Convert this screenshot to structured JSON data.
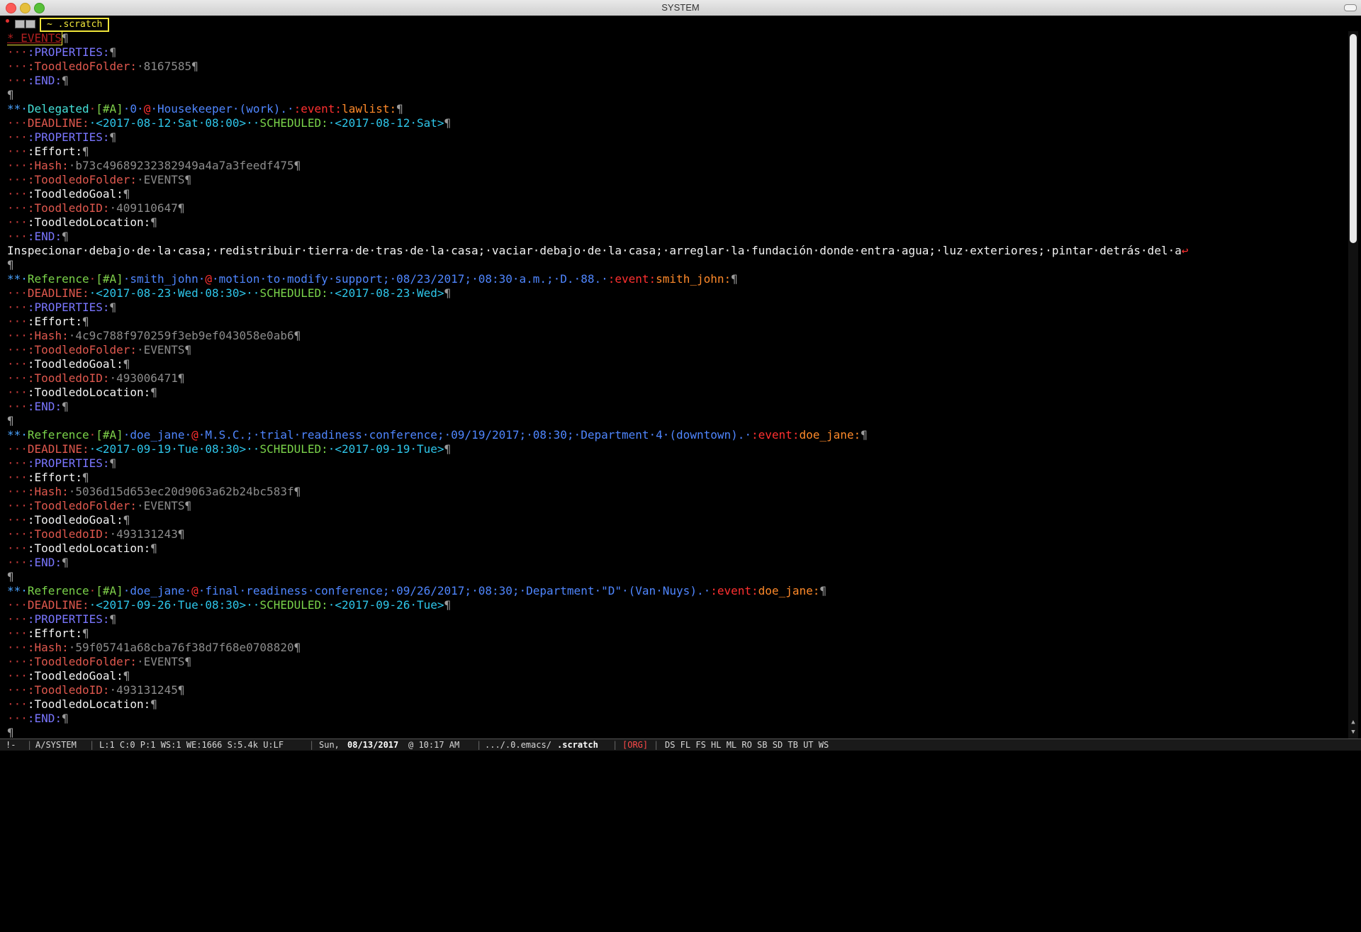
{
  "window": {
    "title": "SYSTEM"
  },
  "tabbar": {
    "buffer_label": "~ .scratch"
  },
  "pilcrow": "¶",
  "lines": [
    {
      "segments": [
        {
          "t": "* EVENTS",
          "c": "head-events cursor"
        },
        {
          "t": "¶",
          "c": "pilcrow"
        }
      ]
    },
    {
      "segments": [
        {
          "t": "···",
          "c": "dots"
        },
        {
          "t": ":PROPERTIES:",
          "c": "drawer"
        },
        {
          "t": "¶",
          "c": "pilcrow"
        }
      ]
    },
    {
      "segments": [
        {
          "t": "···",
          "c": "dots"
        },
        {
          "t": ":ToodledoFolder:",
          "c": "kw-red"
        },
        {
          "t": "·8167585",
          "c": "val-gray"
        },
        {
          "t": "¶",
          "c": "pilcrow"
        }
      ]
    },
    {
      "segments": [
        {
          "t": "···",
          "c": "dots"
        },
        {
          "t": ":END:",
          "c": "drawer"
        },
        {
          "t": "¶",
          "c": "pilcrow"
        }
      ]
    },
    {
      "segments": [
        {
          "t": "¶",
          "c": "pilcrow"
        }
      ]
    },
    {
      "segments": [
        {
          "t": "**·",
          "c": "star"
        },
        {
          "t": "Delegated",
          "c": "todo"
        },
        {
          "t": "·",
          "c": "dots"
        },
        {
          "t": "[#A]",
          "c": "prio"
        },
        {
          "t": "·0·",
          "c": "blue"
        },
        {
          "t": "@",
          "c": "event-red"
        },
        {
          "t": "·Housekeeper·(work).·",
          "c": "blue"
        },
        {
          "t": ":event:",
          "c": "event-red"
        },
        {
          "t": "lawlist:",
          "c": "tag-orange"
        },
        {
          "t": "¶",
          "c": "pilcrow"
        }
      ]
    },
    {
      "segments": [
        {
          "t": "···",
          "c": "dots"
        },
        {
          "t": "DEADLINE:",
          "c": "kw-red"
        },
        {
          "t": "·<2017-08-12·Sat·08:00>··",
          "c": "cyan"
        },
        {
          "t": "SCHEDULED:",
          "c": "green"
        },
        {
          "t": "·<2017-08-12·Sat>",
          "c": "cyan"
        },
        {
          "t": "¶",
          "c": "pilcrow"
        }
      ]
    },
    {
      "segments": [
        {
          "t": "···",
          "c": "dots"
        },
        {
          "t": ":PROPERTIES:",
          "c": "drawer"
        },
        {
          "t": "¶",
          "c": "pilcrow"
        }
      ]
    },
    {
      "segments": [
        {
          "t": "···",
          "c": "dots"
        },
        {
          "t": ":Effort:",
          "c": "kw-white"
        },
        {
          "t": "¶",
          "c": "pilcrow"
        }
      ]
    },
    {
      "segments": [
        {
          "t": "···",
          "c": "dots"
        },
        {
          "t": ":Hash:",
          "c": "kw-red"
        },
        {
          "t": "·b73c49689232382949a4a7a3feedf475",
          "c": "val-gray"
        },
        {
          "t": "¶",
          "c": "pilcrow"
        }
      ]
    },
    {
      "segments": [
        {
          "t": "···",
          "c": "dots"
        },
        {
          "t": ":ToodledoFolder:",
          "c": "kw-red"
        },
        {
          "t": "·EVENTS",
          "c": "val-gray"
        },
        {
          "t": "¶",
          "c": "pilcrow"
        }
      ]
    },
    {
      "segments": [
        {
          "t": "···",
          "c": "dots"
        },
        {
          "t": ":ToodledoGoal:",
          "c": "kw-white"
        },
        {
          "t": "¶",
          "c": "pilcrow"
        }
      ]
    },
    {
      "segments": [
        {
          "t": "···",
          "c": "dots"
        },
        {
          "t": ":ToodledoID:",
          "c": "kw-red"
        },
        {
          "t": "·409110647",
          "c": "val-gray"
        },
        {
          "t": "¶",
          "c": "pilcrow"
        }
      ]
    },
    {
      "segments": [
        {
          "t": "···",
          "c": "dots"
        },
        {
          "t": ":ToodledoLocation:",
          "c": "kw-white"
        },
        {
          "t": "¶",
          "c": "pilcrow"
        }
      ]
    },
    {
      "segments": [
        {
          "t": "···",
          "c": "dots"
        },
        {
          "t": ":END:",
          "c": "drawer"
        },
        {
          "t": "¶",
          "c": "pilcrow"
        }
      ]
    },
    {
      "segments": [
        {
          "t": "Inspecionar·debajo·de·la·casa;·redistribuir·tierra·de·tras·de·la·casa;·vaciar·debajo·de·la·casa;·arreglar·la·fundación·donde·entra·agua;·luz·exteriores;·pintar·detrás·del·a",
          "c": "kw-white"
        },
        {
          "t": "↩",
          "c": "event-red"
        }
      ]
    },
    {
      "segments": [
        {
          "t": "¶",
          "c": "pilcrow"
        }
      ]
    },
    {
      "segments": [
        {
          "t": "**·",
          "c": "star"
        },
        {
          "t": "Reference",
          "c": "green"
        },
        {
          "t": "·",
          "c": "dots"
        },
        {
          "t": "[#A]",
          "c": "prio"
        },
        {
          "t": "·smith_john·",
          "c": "blue"
        },
        {
          "t": "@",
          "c": "event-red"
        },
        {
          "t": "·motion·to·modify·support;·08/23/2017;·08:30·a.m.;·D.·88.·",
          "c": "blue"
        },
        {
          "t": ":event:",
          "c": "event-red"
        },
        {
          "t": "smith_john:",
          "c": "tag-orange"
        },
        {
          "t": "¶",
          "c": "pilcrow"
        }
      ]
    },
    {
      "segments": [
        {
          "t": "···",
          "c": "dots"
        },
        {
          "t": "DEADLINE:",
          "c": "kw-red"
        },
        {
          "t": "·<2017-08-23·Wed·08:30>··",
          "c": "cyan"
        },
        {
          "t": "SCHEDULED:",
          "c": "green"
        },
        {
          "t": "·<2017-08-23·Wed>",
          "c": "cyan"
        },
        {
          "t": "¶",
          "c": "pilcrow"
        }
      ]
    },
    {
      "segments": [
        {
          "t": "···",
          "c": "dots"
        },
        {
          "t": ":PROPERTIES:",
          "c": "drawer"
        },
        {
          "t": "¶",
          "c": "pilcrow"
        }
      ]
    },
    {
      "segments": [
        {
          "t": "···",
          "c": "dots"
        },
        {
          "t": ":Effort:",
          "c": "kw-white"
        },
        {
          "t": "¶",
          "c": "pilcrow"
        }
      ]
    },
    {
      "segments": [
        {
          "t": "···",
          "c": "dots"
        },
        {
          "t": ":Hash:",
          "c": "kw-red"
        },
        {
          "t": "·4c9c788f970259f3eb9ef043058e0ab6",
          "c": "val-gray"
        },
        {
          "t": "¶",
          "c": "pilcrow"
        }
      ]
    },
    {
      "segments": [
        {
          "t": "···",
          "c": "dots"
        },
        {
          "t": ":ToodledoFolder:",
          "c": "kw-red"
        },
        {
          "t": "·EVENTS",
          "c": "val-gray"
        },
        {
          "t": "¶",
          "c": "pilcrow"
        }
      ]
    },
    {
      "segments": [
        {
          "t": "···",
          "c": "dots"
        },
        {
          "t": ":ToodledoGoal:",
          "c": "kw-white"
        },
        {
          "t": "¶",
          "c": "pilcrow"
        }
      ]
    },
    {
      "segments": [
        {
          "t": "···",
          "c": "dots"
        },
        {
          "t": ":ToodledoID:",
          "c": "kw-red"
        },
        {
          "t": "·493006471",
          "c": "val-gray"
        },
        {
          "t": "¶",
          "c": "pilcrow"
        }
      ]
    },
    {
      "segments": [
        {
          "t": "···",
          "c": "dots"
        },
        {
          "t": ":ToodledoLocation:",
          "c": "kw-white"
        },
        {
          "t": "¶",
          "c": "pilcrow"
        }
      ]
    },
    {
      "segments": [
        {
          "t": "···",
          "c": "dots"
        },
        {
          "t": ":END:",
          "c": "drawer"
        },
        {
          "t": "¶",
          "c": "pilcrow"
        }
      ]
    },
    {
      "segments": [
        {
          "t": "¶",
          "c": "pilcrow"
        }
      ]
    },
    {
      "segments": [
        {
          "t": "**·",
          "c": "star"
        },
        {
          "t": "Reference",
          "c": "green"
        },
        {
          "t": "·",
          "c": "dots"
        },
        {
          "t": "[#A]",
          "c": "prio"
        },
        {
          "t": "·doe_jane·",
          "c": "blue"
        },
        {
          "t": "@",
          "c": "event-red"
        },
        {
          "t": "·M.S.C.;·trial·readiness·conference;·09/19/2017;·08:30;·Department·4·(downtown).·",
          "c": "blue"
        },
        {
          "t": ":event:",
          "c": "event-red"
        },
        {
          "t": "doe_jane:",
          "c": "tag-orange"
        },
        {
          "t": "¶",
          "c": "pilcrow"
        }
      ]
    },
    {
      "segments": [
        {
          "t": "···",
          "c": "dots"
        },
        {
          "t": "DEADLINE:",
          "c": "kw-red"
        },
        {
          "t": "·<2017-09-19·Tue·08:30>··",
          "c": "cyan"
        },
        {
          "t": "SCHEDULED:",
          "c": "green"
        },
        {
          "t": "·<2017-09-19·Tue>",
          "c": "cyan"
        },
        {
          "t": "¶",
          "c": "pilcrow"
        }
      ]
    },
    {
      "segments": [
        {
          "t": "···",
          "c": "dots"
        },
        {
          "t": ":PROPERTIES:",
          "c": "drawer"
        },
        {
          "t": "¶",
          "c": "pilcrow"
        }
      ]
    },
    {
      "segments": [
        {
          "t": "···",
          "c": "dots"
        },
        {
          "t": ":Effort:",
          "c": "kw-white"
        },
        {
          "t": "¶",
          "c": "pilcrow"
        }
      ]
    },
    {
      "segments": [
        {
          "t": "···",
          "c": "dots"
        },
        {
          "t": ":Hash:",
          "c": "kw-red"
        },
        {
          "t": "·5036d15d653ec20d9063a62b24bc583f",
          "c": "val-gray"
        },
        {
          "t": "¶",
          "c": "pilcrow"
        }
      ]
    },
    {
      "segments": [
        {
          "t": "···",
          "c": "dots"
        },
        {
          "t": ":ToodledoFolder:",
          "c": "kw-red"
        },
        {
          "t": "·EVENTS",
          "c": "val-gray"
        },
        {
          "t": "¶",
          "c": "pilcrow"
        }
      ]
    },
    {
      "segments": [
        {
          "t": "···",
          "c": "dots"
        },
        {
          "t": ":ToodledoGoal:",
          "c": "kw-white"
        },
        {
          "t": "¶",
          "c": "pilcrow"
        }
      ]
    },
    {
      "segments": [
        {
          "t": "···",
          "c": "dots"
        },
        {
          "t": ":ToodledoID:",
          "c": "kw-red"
        },
        {
          "t": "·493131243",
          "c": "val-gray"
        },
        {
          "t": "¶",
          "c": "pilcrow"
        }
      ]
    },
    {
      "segments": [
        {
          "t": "···",
          "c": "dots"
        },
        {
          "t": ":ToodledoLocation:",
          "c": "kw-white"
        },
        {
          "t": "¶",
          "c": "pilcrow"
        }
      ]
    },
    {
      "segments": [
        {
          "t": "···",
          "c": "dots"
        },
        {
          "t": ":END:",
          "c": "drawer"
        },
        {
          "t": "¶",
          "c": "pilcrow"
        }
      ]
    },
    {
      "segments": [
        {
          "t": "¶",
          "c": "pilcrow"
        }
      ]
    },
    {
      "segments": [
        {
          "t": "**·",
          "c": "star"
        },
        {
          "t": "Reference",
          "c": "green"
        },
        {
          "t": "·",
          "c": "dots"
        },
        {
          "t": "[#A]",
          "c": "prio"
        },
        {
          "t": "·doe_jane·",
          "c": "blue"
        },
        {
          "t": "@",
          "c": "event-red"
        },
        {
          "t": "·final·readiness·conference;·09/26/2017;·08:30;·Department·\"D\"·(Van·Nuys).·",
          "c": "blue"
        },
        {
          "t": ":event:",
          "c": "event-red"
        },
        {
          "t": "doe_jane:",
          "c": "tag-orange"
        },
        {
          "t": "¶",
          "c": "pilcrow"
        }
      ]
    },
    {
      "segments": [
        {
          "t": "···",
          "c": "dots"
        },
        {
          "t": "DEADLINE:",
          "c": "kw-red"
        },
        {
          "t": "·<2017-09-26·Tue·08:30>··",
          "c": "cyan"
        },
        {
          "t": "SCHEDULED:",
          "c": "green"
        },
        {
          "t": "·<2017-09-26·Tue>",
          "c": "cyan"
        },
        {
          "t": "¶",
          "c": "pilcrow"
        }
      ]
    },
    {
      "segments": [
        {
          "t": "···",
          "c": "dots"
        },
        {
          "t": ":PROPERTIES:",
          "c": "drawer"
        },
        {
          "t": "¶",
          "c": "pilcrow"
        }
      ]
    },
    {
      "segments": [
        {
          "t": "···",
          "c": "dots"
        },
        {
          "t": ":Effort:",
          "c": "kw-white"
        },
        {
          "t": "¶",
          "c": "pilcrow"
        }
      ]
    },
    {
      "segments": [
        {
          "t": "···",
          "c": "dots"
        },
        {
          "t": ":Hash:",
          "c": "kw-red"
        },
        {
          "t": "·59f05741a68cba76f38d7f68e0708820",
          "c": "val-gray"
        },
        {
          "t": "¶",
          "c": "pilcrow"
        }
      ]
    },
    {
      "segments": [
        {
          "t": "···",
          "c": "dots"
        },
        {
          "t": ":ToodledoFolder:",
          "c": "kw-red"
        },
        {
          "t": "·EVENTS",
          "c": "val-gray"
        },
        {
          "t": "¶",
          "c": "pilcrow"
        }
      ]
    },
    {
      "segments": [
        {
          "t": "···",
          "c": "dots"
        },
        {
          "t": ":ToodledoGoal:",
          "c": "kw-white"
        },
        {
          "t": "¶",
          "c": "pilcrow"
        }
      ]
    },
    {
      "segments": [
        {
          "t": "···",
          "c": "dots"
        },
        {
          "t": ":ToodledoID:",
          "c": "kw-red"
        },
        {
          "t": "·493131245",
          "c": "val-gray"
        },
        {
          "t": "¶",
          "c": "pilcrow"
        }
      ]
    },
    {
      "segments": [
        {
          "t": "···",
          "c": "dots"
        },
        {
          "t": ":ToodledoLocation:",
          "c": "kw-white"
        },
        {
          "t": "¶",
          "c": "pilcrow"
        }
      ]
    },
    {
      "segments": [
        {
          "t": "···",
          "c": "dots"
        },
        {
          "t": ":END:",
          "c": "drawer"
        },
        {
          "t": "¶",
          "c": "pilcrow"
        }
      ]
    },
    {
      "segments": [
        {
          "t": "¶",
          "c": "pilcrow"
        }
      ]
    }
  ],
  "modeline": {
    "status": "!-",
    "buffer": "A/SYSTEM",
    "position": "L:1 C:0 P:1 WS:1 WE:1666 S:5.4k U:LF",
    "date_prefix": "Sun,",
    "date": "08/13/2017",
    "time": "@ 10:17 AM",
    "path": ".../.0.emacs/",
    "file": ".scratch",
    "mode": "[ORG]",
    "flags": "DS FL FS HL ML RO SB SD TB UT WS"
  },
  "colors": {
    "background": "#000000",
    "cursor": "#f0e63a",
    "heading_star": "#4aa3ff",
    "todo": "#45e0d8",
    "event": "#ff3030",
    "tag": "#ff8a2a"
  }
}
